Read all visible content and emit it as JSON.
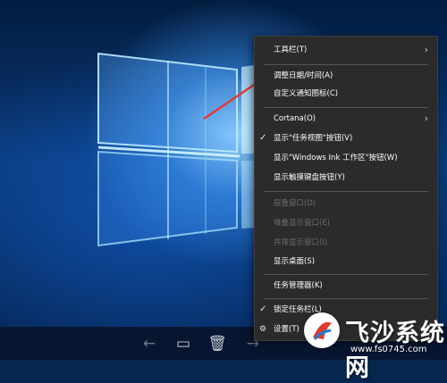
{
  "context_menu": {
    "items": [
      {
        "label": "工具栏(T)",
        "enabled": true,
        "submenu": true,
        "checked": false
      },
      {
        "label": "调整日期/时间(A)",
        "enabled": true,
        "submenu": false,
        "checked": false
      },
      {
        "label": "自定义通知图标(C)",
        "enabled": true,
        "submenu": false,
        "checked": false
      },
      {
        "label": "Cortana(O)",
        "enabled": true,
        "submenu": true,
        "checked": false
      },
      {
        "label": "显示\"任务视图\"按钮(V)",
        "enabled": true,
        "submenu": false,
        "checked": true
      },
      {
        "label": "显示\"Windows Ink 工作区\"按钮(W)",
        "enabled": true,
        "submenu": false,
        "checked": false
      },
      {
        "label": "显示触摸键盘按钮(Y)",
        "enabled": true,
        "submenu": false,
        "checked": false
      },
      {
        "label": "层叠窗口(D)",
        "enabled": false,
        "submenu": false,
        "checked": false
      },
      {
        "label": "堆叠显示窗口(E)",
        "enabled": false,
        "submenu": false,
        "checked": false
      },
      {
        "label": "并排显示窗口(I)",
        "enabled": false,
        "submenu": false,
        "checked": false
      },
      {
        "label": "显示桌面(S)",
        "enabled": true,
        "submenu": false,
        "checked": false
      },
      {
        "label": "任务管理器(K)",
        "enabled": true,
        "submenu": false,
        "checked": false
      },
      {
        "label": "锁定任务栏(L)",
        "enabled": true,
        "submenu": false,
        "checked": true
      },
      {
        "label": "设置(T)",
        "enabled": true,
        "submenu": false,
        "checked": false
      }
    ]
  },
  "icons": {
    "chevron": "›",
    "check": "✓"
  },
  "colors": {
    "menu_bg": "#2b2b2b",
    "annotation_arrow": "#e23b3b",
    "taskbar": "#071630"
  },
  "watermark": {
    "name": "飞沙系统网",
    "url": "www.fs0745.com"
  }
}
